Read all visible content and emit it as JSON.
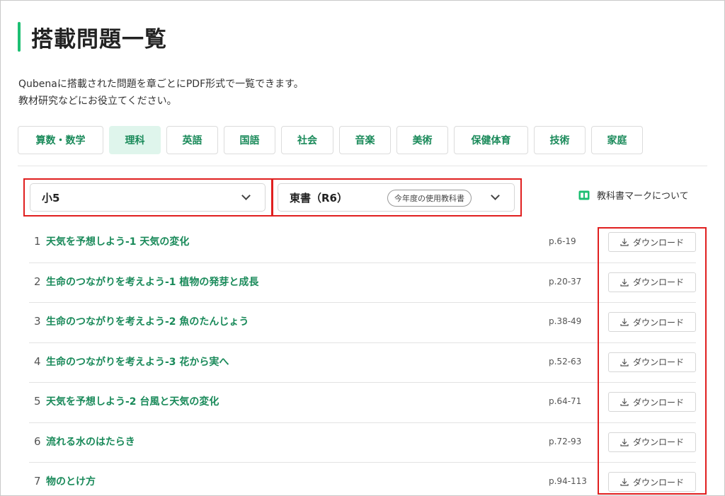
{
  "page": {
    "title": "搭載問題一覧",
    "description_line1": "Qubenaに搭載された問題を章ごとにPDF形式で一覧できます。",
    "description_line2": "教材研究などにお役立てください。",
    "accent_color": "#1dbf73",
    "link_color": "#1a8a5a"
  },
  "subject_tabs": [
    {
      "label": "算数・数学",
      "active": false
    },
    {
      "label": "理科",
      "active": true
    },
    {
      "label": "英語",
      "active": false
    },
    {
      "label": "国語",
      "active": false
    },
    {
      "label": "社会",
      "active": false
    },
    {
      "label": "音楽",
      "active": false
    },
    {
      "label": "美術",
      "active": false
    },
    {
      "label": "保健体育",
      "active": false
    },
    {
      "label": "技術",
      "active": false
    },
    {
      "label": "家庭",
      "active": false
    }
  ],
  "filters": {
    "grade": "小5",
    "textbook": "東書（R6）",
    "textbook_badge": "今年度の使用教科書"
  },
  "textbook_mark_link": "教科書マークについて",
  "chapters": [
    {
      "num": "1",
      "title": "天気を予想しよう-1 天気の変化",
      "pages": "p.6-19",
      "button": "ダウンロード"
    },
    {
      "num": "2",
      "title": "生命のつながりを考えよう-1 植物の発芽と成長",
      "pages": "p.20-37",
      "button": "ダウンロード"
    },
    {
      "num": "3",
      "title": "生命のつながりを考えよう-2 魚のたんじょう",
      "pages": "p.38-49",
      "button": "ダウンロード"
    },
    {
      "num": "4",
      "title": "生命のつながりを考えよう-3 花から実へ",
      "pages": "p.52-63",
      "button": "ダウンロード"
    },
    {
      "num": "5",
      "title": "天気を予想しよう-2 台風と天気の変化",
      "pages": "p.64-71",
      "button": "ダウンロード"
    },
    {
      "num": "6",
      "title": "流れる水のはたらき",
      "pages": "p.72-93",
      "button": "ダウンロード"
    },
    {
      "num": "7",
      "title": "物のとけ方",
      "pages": "p.94-113",
      "button": "ダウンロード"
    }
  ]
}
